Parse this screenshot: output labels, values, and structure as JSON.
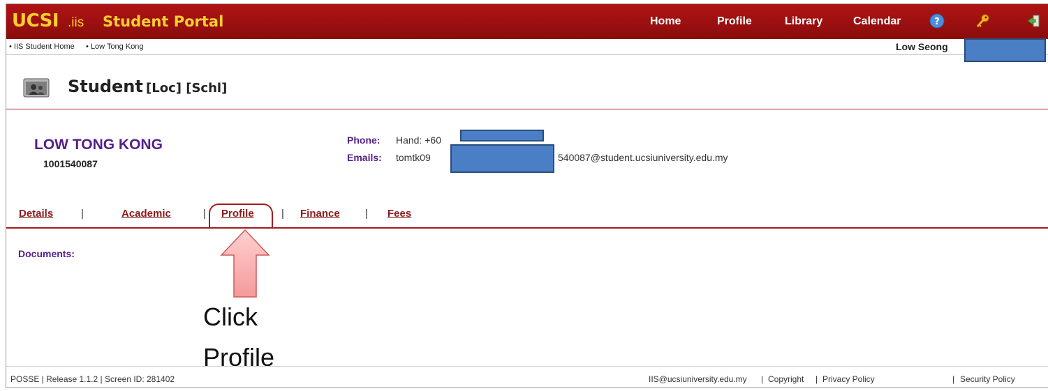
{
  "header": {
    "logo_ucsi": "UCSI",
    "logo_iis": ".iis",
    "portal_title": "Student Portal",
    "nav": [
      "Home",
      "Profile",
      "Library",
      "Calendar"
    ],
    "icons": [
      "help-icon",
      "key-icon",
      "logout-icon"
    ],
    "colors": {
      "bar": "#9f1111",
      "logo": "#ffcf2e"
    }
  },
  "breadcrumb": {
    "items": [
      "• IIS Student Home",
      "• Low Tong Kong"
    ],
    "user": "Low Seong"
  },
  "page": {
    "title": "Student",
    "subtitle": "[Loc] [Schl]",
    "icon": "student-folder-icon"
  },
  "student": {
    "name": "LOW TONG KONG",
    "id": "1001540087",
    "phone_label": "Phone:",
    "phone_value": "Hand: +60",
    "email_label": "Emails:",
    "email_prefix": "tomtk09",
    "email_suffix": "540087@student.ucsiuniversity.edu.my"
  },
  "tabs": [
    "Details",
    "Academic",
    "Profile",
    "Finance",
    "Fees"
  ],
  "content": {
    "documents_label": "Documents:"
  },
  "annotation": {
    "line1": "Click",
    "line2": "Profile",
    "arrow": "up-arrow"
  },
  "footer": {
    "left": "POSSE | Release 1.1.2 | Screen ID: 281402",
    "email": "IIS@ucsiuniversity.edu.my",
    "links": [
      "Copyright",
      "Privacy Policy",
      "Security Policy"
    ],
    "sep": "|"
  }
}
